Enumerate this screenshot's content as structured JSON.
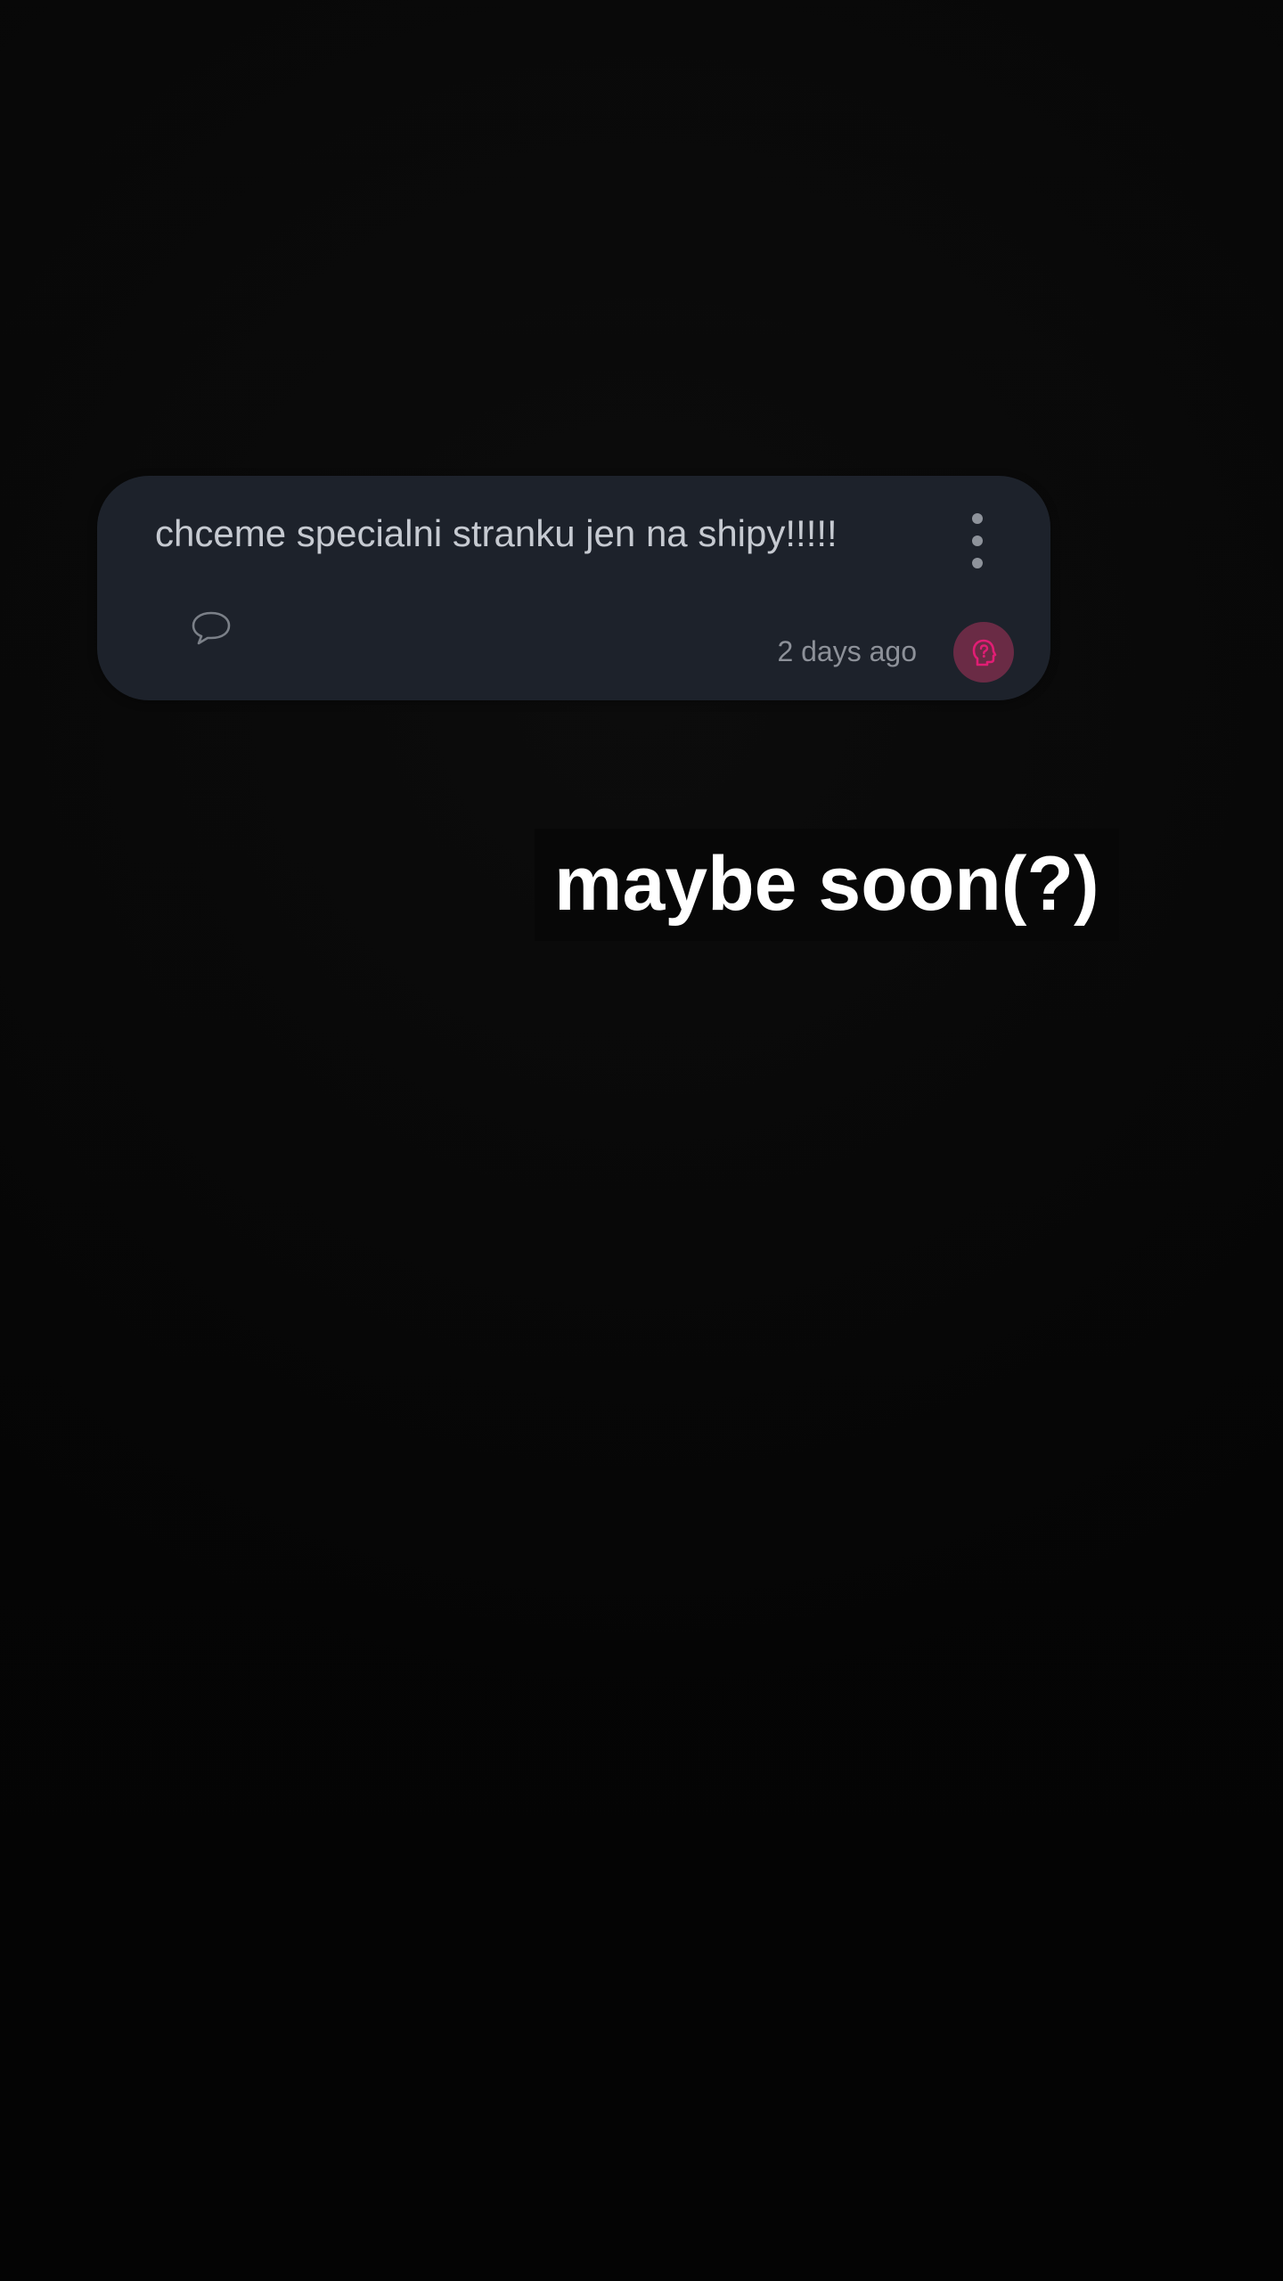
{
  "message": {
    "text": "chceme specialni stranku jen na shipy!!!!!",
    "timestamp": "2 days ago",
    "more_icon": "more-vertical-icon",
    "comment_icon": "speech-bubble-icon",
    "avatar_icon": "question-head-icon",
    "accent_color": "#e11d74"
  },
  "overlay": {
    "caption": "maybe soon(?)"
  }
}
